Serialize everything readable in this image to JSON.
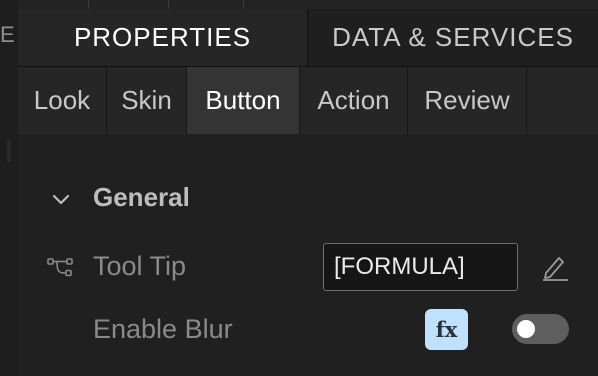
{
  "left_strip": {
    "glyph": "E"
  },
  "main_tabs": [
    {
      "label": "PROPERTIES",
      "active": true
    },
    {
      "label": "DATA & SERVICES",
      "active": false
    }
  ],
  "sub_tabs": [
    {
      "label": "Look"
    },
    {
      "label": "Skin"
    },
    {
      "label": "Button",
      "active": true
    },
    {
      "label": "Action"
    },
    {
      "label": "Review"
    }
  ],
  "section": {
    "title": "General",
    "expanded": true
  },
  "tool_tip": {
    "label": "Tool Tip",
    "icon": "flow-connector-icon",
    "value": "[FORMULA]",
    "edit_icon": "pencil-icon"
  },
  "enable_blur": {
    "label": "Enable Blur",
    "fx_label": "fx",
    "enabled": false
  },
  "colors": {
    "background": "#1b1b1b",
    "fx_button": "#bfe0ff",
    "toggle_off": "#5e5e5e"
  }
}
